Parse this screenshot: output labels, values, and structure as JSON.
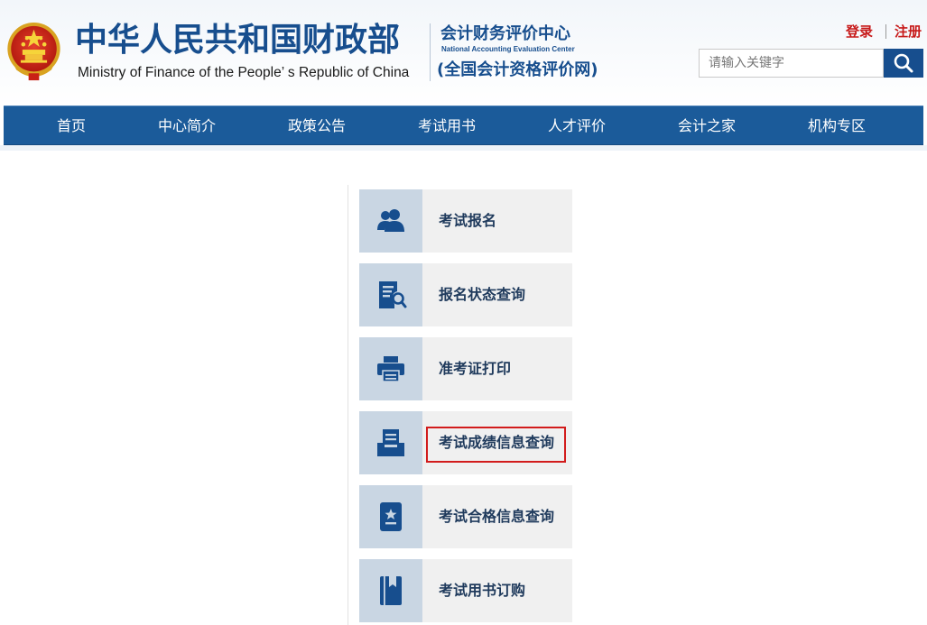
{
  "header": {
    "ministry_cn": "中华人民共和国财政部",
    "ministry_en": "Ministry of Finance of the People’ s Republic of China",
    "center_cn": "会计财务评价中心",
    "center_en": "National Accounting Evaluation Center",
    "center_sub": "(全国会计资格评价网)",
    "login": "登录",
    "register": "注册",
    "search_placeholder": "请输入关键字"
  },
  "nav": {
    "items": [
      {
        "label": "首页"
      },
      {
        "label": "中心简介"
      },
      {
        "label": "政策公告"
      },
      {
        "label": "考试用书"
      },
      {
        "label": "人才评价"
      },
      {
        "label": "会计之家"
      },
      {
        "label": "机构专区"
      }
    ]
  },
  "services": {
    "items": [
      {
        "label": "考试报名",
        "icon": "users-icon"
      },
      {
        "label": "报名状态查询",
        "icon": "document-search-icon"
      },
      {
        "label": "准考证打印",
        "icon": "printer-icon"
      },
      {
        "label": "考试成绩信息查询",
        "icon": "inbox-tray-icon",
        "highlighted": true
      },
      {
        "label": "考试合格信息查询",
        "icon": "certificate-book-icon"
      },
      {
        "label": "考试用书订购",
        "icon": "book-icon"
      }
    ]
  },
  "colors": {
    "brand_blue": "#174e8e",
    "nav_blue": "#1b5b9a",
    "auth_red": "#c71a1a",
    "highlight_red": "#d21c1c",
    "tile_bg": "#f0f0f0",
    "tile_icon_bg": "#c9d6e3"
  }
}
